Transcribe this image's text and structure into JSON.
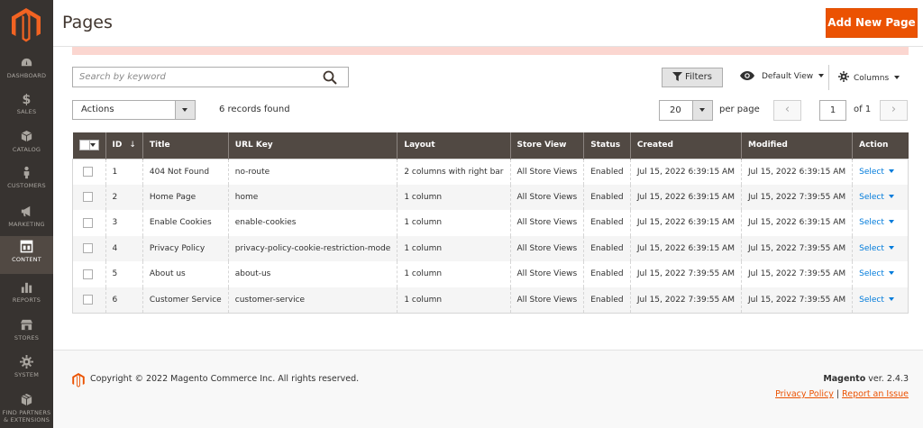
{
  "sidebar": {
    "logo": "magento-logo",
    "items": [
      {
        "label": "DASHBOARD",
        "icon": "dashboard-icon"
      },
      {
        "label": "SALES",
        "icon": "dollar-icon"
      },
      {
        "label": "CATALOG",
        "icon": "cube-icon"
      },
      {
        "label": "CUSTOMERS",
        "icon": "person-icon"
      },
      {
        "label": "MARKETING",
        "icon": "megaphone-icon"
      },
      {
        "label": "CONTENT",
        "icon": "layout-icon"
      },
      {
        "label": "REPORTS",
        "icon": "bar-chart-icon"
      },
      {
        "label": "STORES",
        "icon": "storefront-icon"
      },
      {
        "label": "SYSTEM",
        "icon": "gear-icon"
      },
      {
        "label": "FIND PARTNERS",
        "label2": "& EXTENSIONS",
        "icon": "box-icon"
      }
    ],
    "active": "CONTENT"
  },
  "header": {
    "title": "Pages",
    "add_button": "Add New Page"
  },
  "toolbar": {
    "search_placeholder": "Search by keyword",
    "filters_label": "Filters",
    "view_label": "Default View",
    "columns_label": "Columns",
    "actions_label": "Actions",
    "records_found": "6 records found",
    "per_page_value": "20",
    "per_page_label": "per page",
    "current_page": "1",
    "of_pages": "of 1"
  },
  "grid": {
    "columns": [
      "ID",
      "Title",
      "URL Key",
      "Layout",
      "Store View",
      "Status",
      "Created",
      "Modified",
      "Action"
    ],
    "sort_indicator": "↓",
    "rows": [
      {
        "id": "1",
        "title": "404 Not Found",
        "url_key": "no-route",
        "layout": "2 columns with right bar",
        "store_view": "All Store Views",
        "status": "Enabled",
        "created": "Jul 15, 2022 6:39:15 AM",
        "modified": "Jul 15, 2022 6:39:15 AM",
        "action": "Select"
      },
      {
        "id": "2",
        "title": "Home Page",
        "url_key": "home",
        "layout": "1 column",
        "store_view": "All Store Views",
        "status": "Enabled",
        "created": "Jul 15, 2022 6:39:15 AM",
        "modified": "Jul 15, 2022 7:39:55 AM",
        "action": "Select"
      },
      {
        "id": "3",
        "title": "Enable Cookies",
        "url_key": "enable-cookies",
        "layout": "1 column",
        "store_view": "All Store Views",
        "status": "Enabled",
        "created": "Jul 15, 2022 6:39:15 AM",
        "modified": "Jul 15, 2022 6:39:15 AM",
        "action": "Select"
      },
      {
        "id": "4",
        "title": "Privacy Policy",
        "url_key": "privacy-policy-cookie-restriction-mode",
        "layout": "1 column",
        "store_view": "All Store Views",
        "status": "Enabled",
        "created": "Jul 15, 2022 6:39:15 AM",
        "modified": "Jul 15, 2022 7:39:55 AM",
        "action": "Select"
      },
      {
        "id": "5",
        "title": "About us",
        "url_key": "about-us",
        "layout": "1 column",
        "store_view": "All Store Views",
        "status": "Enabled",
        "created": "Jul 15, 2022 7:39:55 AM",
        "modified": "Jul 15, 2022 7:39:55 AM",
        "action": "Select"
      },
      {
        "id": "6",
        "title": "Customer Service",
        "url_key": "customer-service",
        "layout": "1 column",
        "store_view": "All Store Views",
        "status": "Enabled",
        "created": "Jul 15, 2022 7:39:55 AM",
        "modified": "Jul 15, 2022 7:39:55 AM",
        "action": "Select"
      }
    ]
  },
  "footer": {
    "copyright": "Copyright © 2022 Magento Commerce Inc. All rights reserved.",
    "brand": "Magento",
    "version": " ver. 2.4.3",
    "privacy_link": "Privacy Policy",
    "separator": "|",
    "report_link": "Report an Issue"
  },
  "colors": {
    "accent": "#eb5202",
    "sidebar_bg": "#373330",
    "grid_header_bg": "#514943",
    "link": "#007bdb"
  }
}
